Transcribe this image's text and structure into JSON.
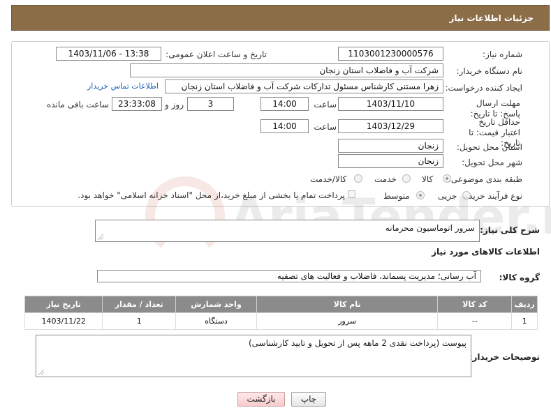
{
  "header": {
    "title": "جزئیات اطلاعات نیاز"
  },
  "form": {
    "need_number": {
      "label": "شماره نیاز:",
      "value": "1103001230000576"
    },
    "announce_datetime": {
      "label": "تاریخ و ساعت اعلان عمومی:",
      "value": "1403/11/06 - 13:38"
    },
    "buyer_org": {
      "label": "نام دستگاه خریدار:",
      "value": "شرکت آب و فاضلاب استان زنجان"
    },
    "requester": {
      "label": "ایجاد کننده درخواست:",
      "value": "زهرا مستنی کارشناس مسئول تدارکات شرکت آب و فاضلاب استان زنجان",
      "contact_link": "اطلاعات تماس خریدار"
    },
    "reply_deadline": {
      "label": "مهلت ارسال پاسخ: تا تاریخ:",
      "date": "1403/11/10",
      "time_label": "ساعت",
      "time": "14:00",
      "days": "3",
      "days_label": "روز و",
      "remaining": "23:33:08",
      "remaining_label": "ساعت باقی مانده"
    },
    "price_validity": {
      "label": "حداقل تاریخ اعتبار قیمت: تا تاریخ:",
      "date": "1403/12/29",
      "time_label": "ساعت",
      "time": "14:00"
    },
    "delivery_province": {
      "label": "استان محل تحویل:",
      "value": "زنجان"
    },
    "delivery_city": {
      "label": "شهر محل تحویل:",
      "value": "زنجان"
    },
    "category": {
      "label": "طبقه بندی موضوعی:",
      "options": [
        "کالا",
        "خدمت",
        "کالا/خدمت"
      ],
      "selected": "کالا"
    },
    "purchase_process": {
      "label": "نوع فرآیند خرید :",
      "options": [
        "جزیی",
        "متوسط"
      ],
      "selected": "متوسط",
      "note": "پرداخت تمام یا بخشی از مبلغ خرید،از محل \"اسناد خزانه اسلامی\" خواهد بود."
    }
  },
  "summary": {
    "label": "شرح کلی نیاز:",
    "value": "سرور اتوماسیون محرمانه"
  },
  "goods_section": {
    "title": "اطلاعات کالاهای مورد نیاز"
  },
  "goods_group": {
    "label": "گروه کالا:",
    "value": "آب رسانی؛ مدیریت پسماند، فاضلاب و فعالیت های تصفیه"
  },
  "table": {
    "headers": [
      "ردیف",
      "کد کالا",
      "نام کالا",
      "واحد شمارش",
      "تعداد / مقدار",
      "تاریخ نیاز"
    ],
    "rows": [
      [
        "1",
        "--",
        "سرور",
        "دستگاه",
        "1",
        "1403/11/22"
      ]
    ]
  },
  "buyer_notes": {
    "label": "توضیحات خریدار:",
    "value": "پیوست (پرداخت نقدی 2 ماهه پس از تحویل و تایید کارشناسی)"
  },
  "buttons": {
    "print": "چاپ",
    "back": "بازگشت"
  },
  "watermark": {
    "text": "AriaTender.net"
  }
}
